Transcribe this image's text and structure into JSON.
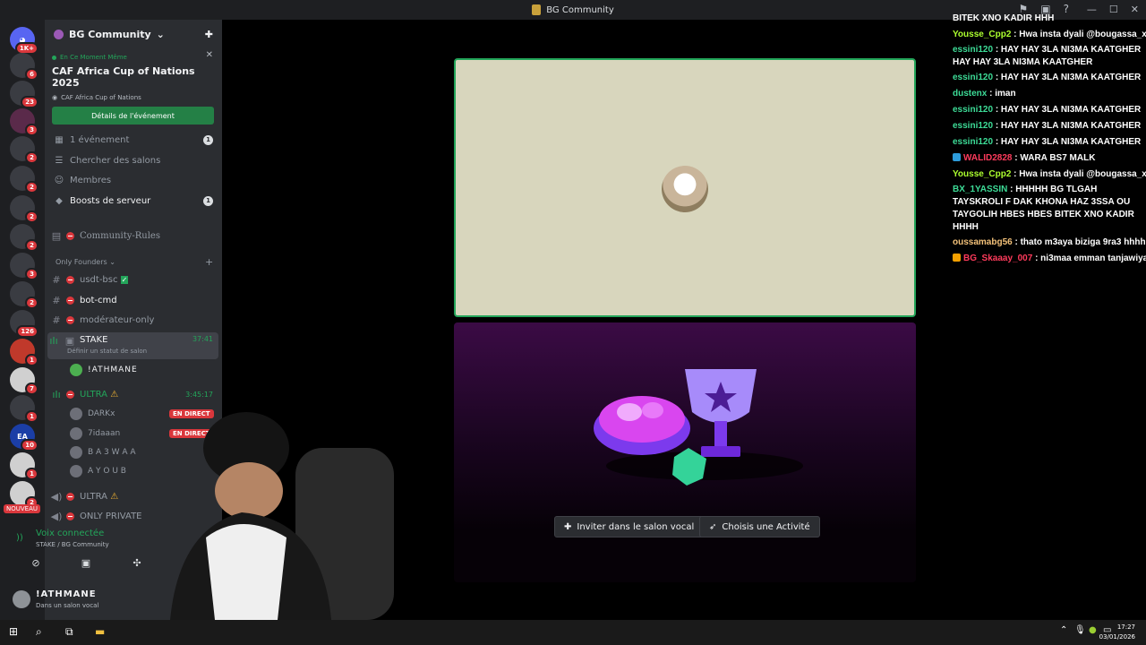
{
  "window": {
    "title": "BG Community"
  },
  "servers": {
    "items": [
      {
        "badge": "1K+"
      },
      {
        "badge": "6"
      },
      {
        "badge": "23"
      },
      {
        "badge": "3"
      },
      {
        "badge": "2"
      },
      {
        "badge": "2"
      },
      {
        "badge": "2"
      },
      {
        "badge": "2"
      },
      {
        "badge": "3"
      },
      {
        "badge": "2"
      },
      {
        "badge": "126"
      },
      {
        "badge": "1"
      },
      {
        "badge": "7"
      },
      {
        "badge": "1"
      },
      {
        "badge": "10"
      },
      {
        "badge": "1"
      },
      {
        "badge": "2"
      }
    ],
    "nouveau": "NOUVEAU",
    "ea_label": "EA"
  },
  "guild": {
    "name": "BG Community"
  },
  "event": {
    "live_label": "En Ce Moment Même",
    "title": "CAF Africa Cup of Nations 2025",
    "location": "CAF Africa Cup of Nations",
    "button": "Détails de l'événement"
  },
  "menu": [
    {
      "label": "1 événement",
      "count": "1"
    },
    {
      "label": "Chercher des salons"
    },
    {
      "label": "Membres"
    },
    {
      "label": "Boosts de serveur",
      "count": "1"
    }
  ],
  "channels": {
    "rules": "Community-Rules",
    "category": "Only Founders",
    "usdt": "usdt-bsc",
    "bot": "bot-cmd",
    "moderateur": "modérateur-only",
    "stake": "STAKE",
    "stake_time": "37:41",
    "stake_status": "Définir un statut de salon",
    "ultra": "ULTRA",
    "ultra_time": "3:45:17",
    "ultra2": "ULTRA",
    "only_private": "ONLY PRIVATE"
  },
  "voice_users": {
    "stake": [
      {
        "name": "!ATHMANE"
      }
    ],
    "ultra": [
      {
        "name": "DARKx",
        "live": "EN DIRECT"
      },
      {
        "name": "7idaaan",
        "live": "EN DIRECT"
      },
      {
        "name": "B A 3 W A A"
      },
      {
        "name": "A Y O U B"
      }
    ]
  },
  "voice_panel": {
    "connected": "Voix connectée",
    "where": "STAKE / BG Community"
  },
  "user_panel": {
    "name": "!ATHMANE",
    "status": "Dans un salon vocal"
  },
  "activity": {
    "invite_button": "Inviter dans le salon vocal",
    "activity_button": "Choisis une Activité"
  },
  "chat": [
    {
      "user": "",
      "text": "BITEK XNO KADIR HHH",
      "color": "#ffffff"
    },
    {
      "user": "Yousse_Cpp2",
      "text": " : Hwa insta dyali @bougassa_x_2",
      "color": "#adff2f"
    },
    {
      "user": "essini120",
      "text": " : HAY HAY 3LA NI3MA KAATGHER HAY HAY 3LA NI3MA KAATGHER",
      "color": "#3ddc97",
      "wrap": true
    },
    {
      "user": "essini120",
      "text": " : HAY HAY 3LA NI3MA KAATGHER",
      "color": "#3ddc97"
    },
    {
      "user": "dustenx",
      "text": " : iman",
      "color": "#3ddc97"
    },
    {
      "user": "essini120",
      "text": " : HAY HAY 3LA NI3MA KAATGHER",
      "color": "#3ddc97"
    },
    {
      "user": "essini120",
      "text": " : HAY HAY 3LA NI3MA KAATGHER",
      "color": "#3ddc97"
    },
    {
      "user": "essini120",
      "text": " : HAY HAY 3LA NI3MA KAATGHER",
      "color": "#3ddc97"
    },
    {
      "user": "WALID2828",
      "text": " : WARA BS7 MALK",
      "color": "#ff3b5c",
      "platform": "#2d9cdb"
    },
    {
      "user": "Yousse_Cpp2",
      "text": " : Hwa insta dyali @bougassa_x_2",
      "color": "#adff2f"
    },
    {
      "user": "BX_1YASSIN",
      "text": " : HHHHH BG TLGAH TAYSKROLI F DAK KHONA HAZ 3SSA OU TAYGOLIH HBES HBES BITEK XNO KADIR HHHH",
      "color": "#3ddc97",
      "wrap": true
    },
    {
      "user": "oussamabg56",
      "text": " : thato m3aya biziga 9ra3 hhhh",
      "color": "#f4c27a"
    },
    {
      "user": "BG_Skaaay_007",
      "text": " : ni3maa emman tanjawiya",
      "color": "#ff3b5c",
      "platform": "#f4a000"
    }
  ],
  "taskbar": {
    "time": "17:27",
    "date": "03/01/2026"
  }
}
